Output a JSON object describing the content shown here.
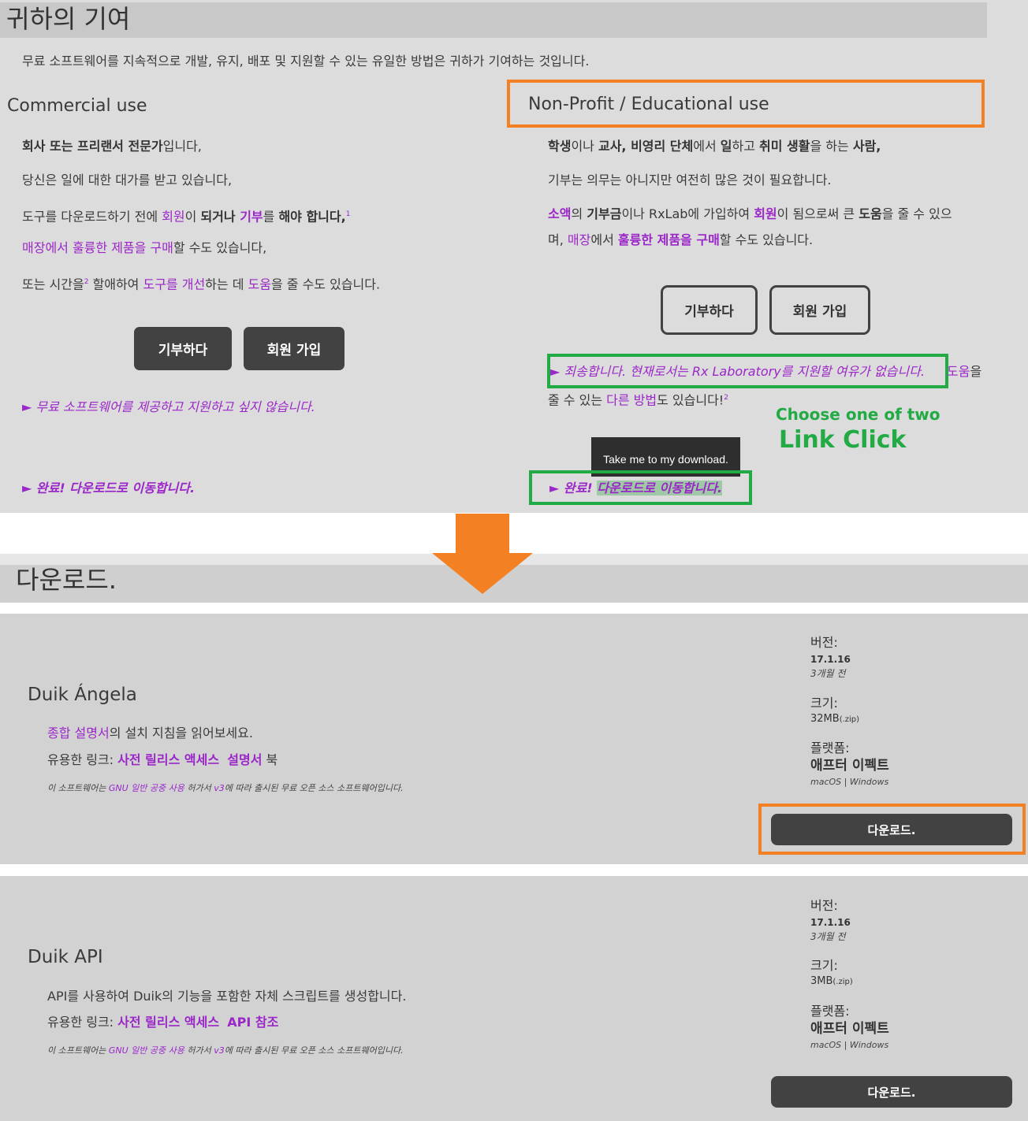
{
  "top": {
    "title": "귀하의 기여",
    "intro": "무료 소프트웨어를 지속적으로 개발, 유지, 배포 및 지원할 수 있는 유일한 방법은 귀하가 기여하는 것입니다.",
    "commercial": {
      "heading": "Commercial use",
      "line1_bold": "회사 또는 프리랜서 전문가",
      "line1_rest": "입니다,",
      "line2": "당신은 일에 대한 대가를 받고 있습니다,",
      "line3_a": "도구를 다운로드하기 전에 ",
      "line3_member": "회원",
      "line3_b": "이 ",
      "line3_becomeor": "되거나 ",
      "line3_donate": "기부",
      "line3_c": "를 ",
      "line3_must": "해야 합니다",
      "line3_d": ",",
      "line3_sup": "1",
      "line4_link": "매장에서 훌륭한 제품을 구매",
      "line4_rest": "할 수도 있습니다,",
      "line5_a": "또는 시간을",
      "line5_sup": "2",
      "line5_b": " 할애하여 ",
      "line5_link1": "도구를 개선",
      "line5_c": "하는 데 ",
      "line5_link2": "도움",
      "line5_d": "을 줄 수도 있습니다.",
      "donate_btn": "기부하다",
      "join_btn": "회원 가입",
      "decline_link": "► 무료 소프트웨어를 제공하고 지원하고 싶지 않습니다.",
      "done_link": "► 완료! 다운로드로 이동합니다."
    },
    "nonprofit": {
      "heading": "Non-Profit / Educational use",
      "line1_a": "학생",
      "line1_b": "이나 ",
      "line1_c": "교사, 비영리 단체",
      "line1_d": "에서 ",
      "line1_e": "일",
      "line1_f": "하고 ",
      "line1_g": "취미 생활",
      "line1_h": "을 하는 ",
      "line1_i": "사람,",
      "line2": "기부는 의무는 아니지만 여전히 많은 것이 필요합니다.",
      "line3_link1": "소액",
      "line3_a": "의 ",
      "line3_b": "기부금",
      "line3_c": "이나 RxLab에 가입하여 ",
      "line3_link2": "회원",
      "line3_d": "이 됨으로써 큰 ",
      "line3_e": "도움",
      "line3_f": "을 줄 수 있으",
      "line4_a": "며, ",
      "line4_link1": "매장",
      "line4_b": "에서 ",
      "line4_link2": "훌륭한 제품을 구매",
      "line4_c": "할 수도 있습니다.",
      "donate_btn": "기부하다",
      "join_btn": "회원 가입",
      "sorry_link": "► 죄송합니다. 현재로서는 Rx Laboratory를 지원할 여유가 없습니다.",
      "sorry_tail_link": "도움",
      "sorry_tail_rest": "을",
      "line6_a": "줄 수 있는 ",
      "line6_link": "다른 방법",
      "line6_b": "도 있습니다!",
      "line6_sup": "2",
      "tooltip": "Take me to my download.",
      "done_link_a": "► 완료! ",
      "done_link_b": "다운로드로 이동합니다."
    },
    "annotation_line1": "Choose one of two",
    "annotation_line2": "Link Click"
  },
  "downloads": {
    "title": "다운로드.",
    "cards": [
      {
        "name": "Duik Ángela",
        "desc_link": "종합 설명서",
        "desc_rest": "의 설치 지침을 읽어보세요.",
        "links_label": "유용한 링크: ",
        "link1": "사전 릴리스 액세스",
        "link2": "설명서",
        "link3": " 북",
        "license_a": "이 소프트웨어는 ",
        "license_link": "GNU 일반 공중 사용",
        "license_b": " 허가서 ",
        "license_v": "v3",
        "license_c": "에 따라 출시된 무료 오픈 소스 소프트웨어입니다.",
        "version_label": "버전:",
        "version": "17.1.16",
        "version_age": "3개월 전",
        "size_label": "크기:",
        "size": "32MB",
        "size_ext": "(.zip)",
        "platform_label": "플랫폼:",
        "platform": "애프터 이펙트",
        "os": "macOS | Windows",
        "button": "다운로드."
      },
      {
        "name": "Duik API",
        "desc_link": "",
        "desc_rest": "API를 사용하여 Duik의 기능을 포함한 자체 스크립트를 생성합니다.",
        "links_label": "유용한 링크: ",
        "link1": "사전 릴리스 액세스",
        "link2": "API 참조",
        "link3": "",
        "license_a": "이 소프트웨어는 ",
        "license_link": "GNU 일반 공중 사용",
        "license_b": " 허가서 ",
        "license_v": "v3",
        "license_c": "에 따라 출시된 무료 오픈 소스 소프트웨어입니다.",
        "version_label": "버전:",
        "version": "17.1.16",
        "version_age": "3개월 전",
        "size_label": "크기:",
        "size": "3MB",
        "size_ext": "(.zip)",
        "platform_label": "플랫폼:",
        "platform": "애프터 이펙트",
        "os": "macOS | Windows",
        "button": "다운로드."
      }
    ]
  },
  "colors": {
    "accent": "#9b27c9",
    "orange": "#f48024",
    "green": "#22aa44",
    "button": "#424242"
  }
}
